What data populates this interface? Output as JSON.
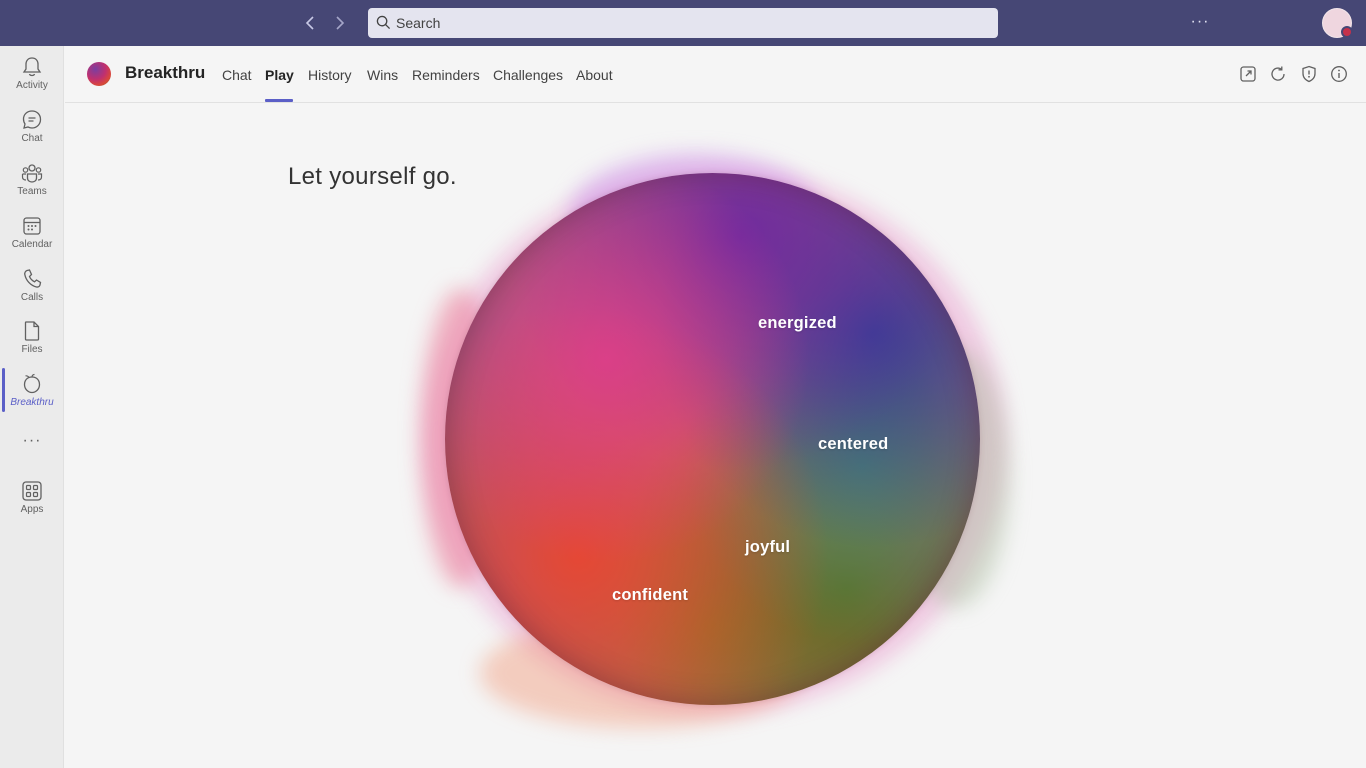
{
  "topbar": {
    "search_placeholder": "Search",
    "more_label": "···"
  },
  "rail": {
    "items": [
      {
        "label": "Activity",
        "icon": "bell-icon"
      },
      {
        "label": "Chat",
        "icon": "chat-icon"
      },
      {
        "label": "Teams",
        "icon": "teams-icon"
      },
      {
        "label": "Calendar",
        "icon": "calendar-icon"
      },
      {
        "label": "Calls",
        "icon": "phone-icon"
      },
      {
        "label": "Files",
        "icon": "file-icon"
      },
      {
        "label": "Breakthru",
        "icon": "breakthru-icon",
        "active": true
      },
      {
        "label": "Apps",
        "icon": "apps-icon"
      }
    ],
    "more_label": "···"
  },
  "app": {
    "name": "Breakthru",
    "tabs": [
      {
        "label": "Chat"
      },
      {
        "label": "Play",
        "active": true
      },
      {
        "label": "History"
      },
      {
        "label": "Wins"
      },
      {
        "label": "Reminders"
      },
      {
        "label": "Challenges"
      },
      {
        "label": "About"
      }
    ]
  },
  "main": {
    "tagline": "Let yourself go.",
    "moods": [
      "energized",
      "centered",
      "joyful",
      "confident"
    ]
  },
  "colors": {
    "titlebar": "#464775",
    "accent": "#5b5fc7"
  }
}
